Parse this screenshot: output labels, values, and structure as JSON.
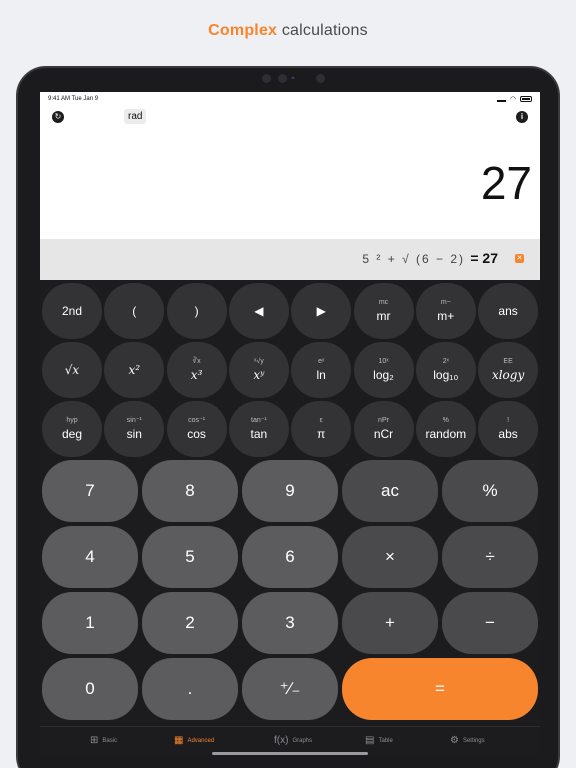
{
  "headline": {
    "accent": "Complex",
    "rest": "calculations"
  },
  "status": {
    "time": "9:41 AM",
    "date": "Tue Jan 9"
  },
  "topbar": {
    "mode": "rad"
  },
  "display": {
    "result": "27",
    "expression": "5 ² + √ (6 − 2)",
    "expression_result": "= 27"
  },
  "sci_keys": [
    {
      "sub": "",
      "main": "2nd"
    },
    {
      "sub": "",
      "main": "("
    },
    {
      "sub": "",
      "main": ")"
    },
    {
      "sub": "",
      "main": "◀"
    },
    {
      "sub": "",
      "main": "▶"
    },
    {
      "sub": "mc",
      "main": "mr"
    },
    {
      "sub": "m−",
      "main": "m+"
    },
    {
      "sub": "",
      "main": "ans"
    },
    {
      "sub": "",
      "main": "√x"
    },
    {
      "sub": "",
      "main": "x²"
    },
    {
      "sub": "∛x",
      "main": "x³"
    },
    {
      "sub": "ˣ√y",
      "main": "xʸ"
    },
    {
      "sub": "eˣ",
      "main": "ln"
    },
    {
      "sub": "10ˣ",
      "main": "log₂"
    },
    {
      "sub": "2ˣ",
      "main": "log₁₀"
    },
    {
      "sub": "EE",
      "main": "xlogy"
    },
    {
      "sub": "hyp",
      "main": "deg"
    },
    {
      "sub": "sin⁻¹",
      "main": "sin"
    },
    {
      "sub": "cos⁻¹",
      "main": "cos"
    },
    {
      "sub": "tan⁻¹",
      "main": "tan"
    },
    {
      "sub": "ε",
      "main": "π"
    },
    {
      "sub": "nPr",
      "main": "nCr"
    },
    {
      "sub": "%",
      "main": "random"
    },
    {
      "sub": "!",
      "main": "abs"
    }
  ],
  "num_keys": [
    [
      "7",
      "8",
      "9",
      "ac",
      "%"
    ],
    [
      "4",
      "5",
      "6",
      "×",
      "÷"
    ],
    [
      "1",
      "2",
      "3",
      "+",
      "−"
    ],
    [
      "0",
      ".",
      "⁺∕₋",
      "="
    ]
  ],
  "tabs": [
    {
      "icon": "grid-icon",
      "glyph": "⊞",
      "label": "Basic",
      "active": false
    },
    {
      "icon": "keypad-icon",
      "glyph": "▦",
      "label": "Advanced",
      "active": true
    },
    {
      "icon": "function-icon",
      "glyph": "f(x)",
      "label": "Graphs",
      "active": false
    },
    {
      "icon": "table-icon",
      "glyph": "▤",
      "label": "Table",
      "active": false
    },
    {
      "icon": "settings-icon",
      "glyph": "⚙",
      "label": "Settings",
      "active": false
    }
  ],
  "colors": {
    "accent": "#f7852d",
    "keypad_bg": "#1c1c1e",
    "num_key": "#5c5c5e",
    "sci_key": "#333335"
  }
}
